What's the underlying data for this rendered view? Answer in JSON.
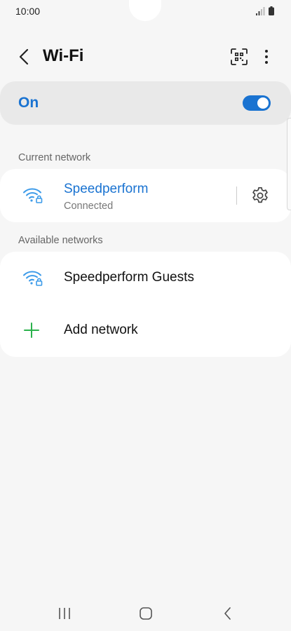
{
  "status_bar": {
    "time": "10:00",
    "icons": [
      "signal-icon",
      "battery-icon"
    ]
  },
  "header": {
    "title": "Wi-Fi",
    "icons": [
      "back-icon",
      "qr-scan-icon",
      "more-options-icon"
    ]
  },
  "wifi_toggle": {
    "label": "On",
    "enabled": true
  },
  "current_network": {
    "section_label": "Current network",
    "name": "Speedperform",
    "status": "Connected",
    "icon": "wifi-lock-icon"
  },
  "available_networks": {
    "section_label": "Available networks",
    "items": [
      {
        "name": "Speedperform Guests",
        "icon": "wifi-lock-icon"
      }
    ],
    "add_label": "Add network"
  },
  "colors": {
    "accent": "#1a73d1",
    "wifi_icon": "#3d9be9",
    "add_icon": "#2bb24c",
    "background": "#f6f6f6",
    "card": "#ffffff"
  },
  "nav_bar": {
    "icons": [
      "recent-apps-icon",
      "home-icon",
      "back-nav-icon"
    ]
  }
}
